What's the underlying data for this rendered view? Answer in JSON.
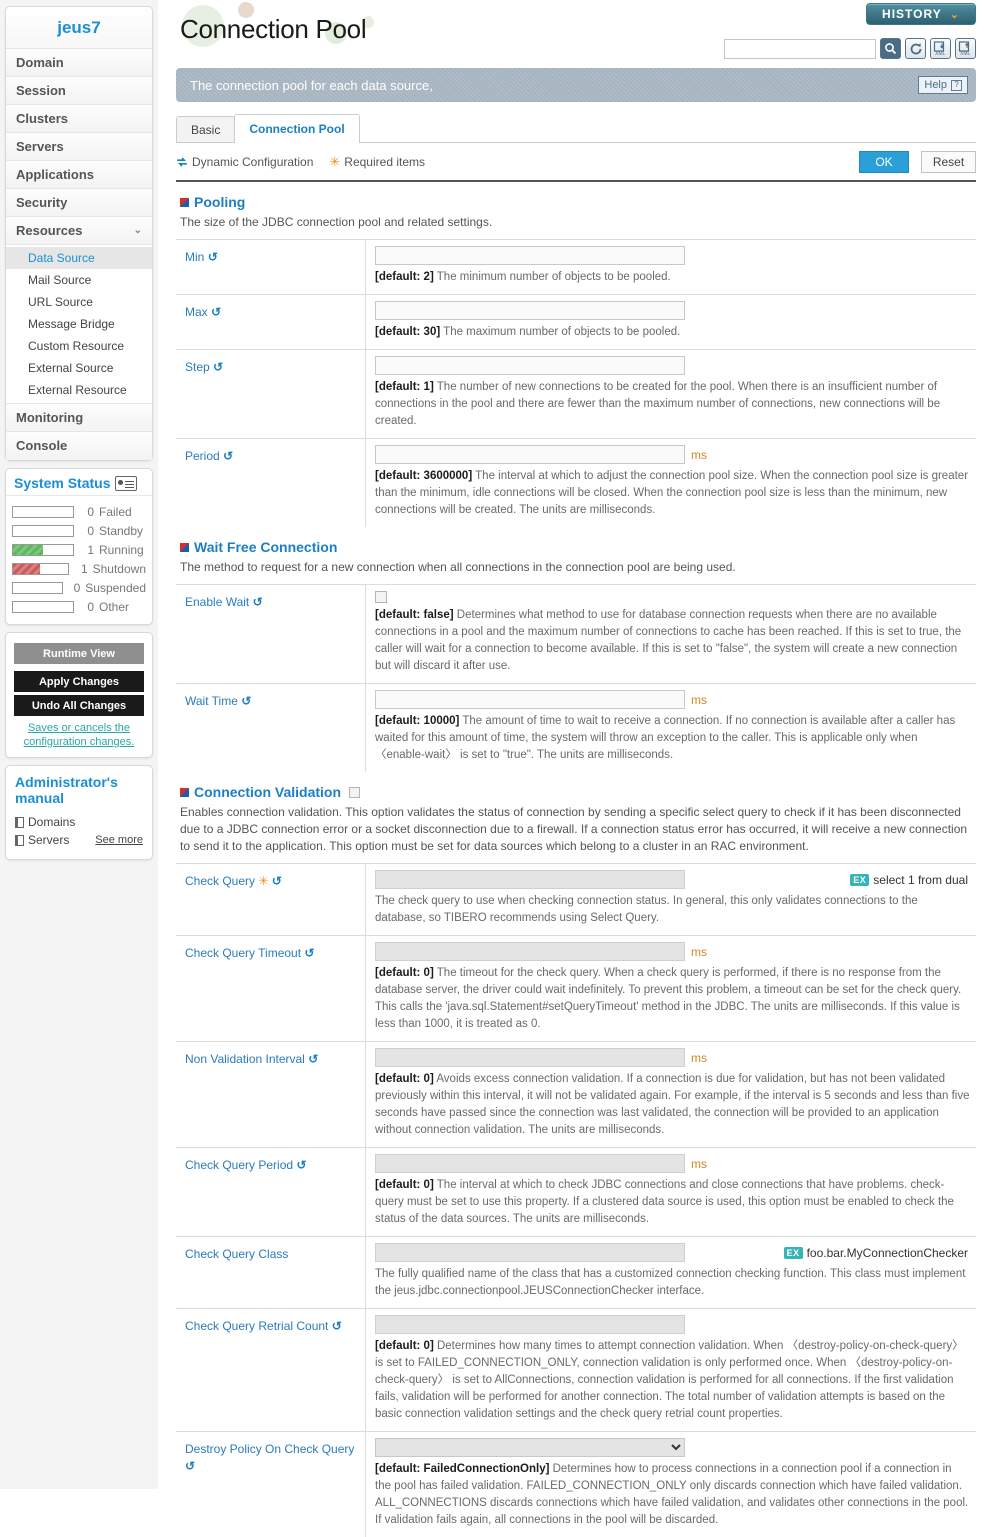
{
  "sidebar": {
    "brand": "jeus7",
    "nav": [
      {
        "label": "Domain",
        "expandable": false
      },
      {
        "label": "Session",
        "expandable": false
      },
      {
        "label": "Clusters",
        "expandable": false
      },
      {
        "label": "Servers",
        "expandable": false
      },
      {
        "label": "Applications",
        "expandable": false
      },
      {
        "label": "Security",
        "expandable": false
      },
      {
        "label": "Resources",
        "expandable": true,
        "chevron": "⌄"
      }
    ],
    "sub_items": [
      {
        "label": "Data Source",
        "active": true
      },
      {
        "label": "Mail Source",
        "active": false
      },
      {
        "label": "URL Source",
        "active": false
      },
      {
        "label": "Message Bridge",
        "active": false
      },
      {
        "label": "Custom Resource",
        "active": false
      },
      {
        "label": "External Source",
        "active": false
      },
      {
        "label": "External Resource",
        "active": false
      }
    ],
    "nav_tail": [
      {
        "label": "Monitoring"
      },
      {
        "label": "Console"
      }
    ],
    "system_status": {
      "title": "System Status",
      "rows": [
        {
          "count": "0",
          "label": "Failed",
          "pct": 0,
          "color": ""
        },
        {
          "count": "0",
          "label": "Standby",
          "pct": 0,
          "color": ""
        },
        {
          "count": "1",
          "label": "Running",
          "pct": 50,
          "color": "green"
        },
        {
          "count": "1",
          "label": "Shutdown",
          "pct": 50,
          "color": "red"
        },
        {
          "count": "0",
          "label": "Suspended",
          "pct": 0,
          "color": ""
        },
        {
          "count": "0",
          "label": "Other",
          "pct": 0,
          "color": ""
        }
      ]
    },
    "actions": {
      "runtime_view": "Runtime View",
      "apply_changes": "Apply Changes",
      "undo_all": "Undo All Changes",
      "note": "Saves or cancels the configuration changes."
    },
    "manual": {
      "title": "Administrator's manual",
      "links": [
        "Domains",
        "Servers"
      ],
      "see_more": "See more"
    }
  },
  "header": {
    "title": "Connection Pool",
    "history_label": "HISTORY",
    "history_chevron": "⌄",
    "search_value": "",
    "search_placeholder": "",
    "subtitle": "The connection pool for each data source,",
    "help_label": "Help",
    "help_mark": "?"
  },
  "tabs": [
    {
      "label": "Basic",
      "active": false
    },
    {
      "label": "Connection Pool",
      "active": true
    }
  ],
  "legend": {
    "dynamic_configuration": "Dynamic Configuration",
    "required_items": "Required items",
    "ok": "OK",
    "reset": "Reset"
  },
  "sections": [
    {
      "title": "Pooling",
      "description": "The size of the JDBC connection pool and related settings.",
      "has_checkbox": false,
      "rows": [
        {
          "label": "Min",
          "dynamic": true,
          "required": false,
          "control": "text",
          "value": "",
          "unit": "",
          "disabled": false,
          "default_label": "[default: 2]",
          "description": "The minimum number of objects to be pooled."
        },
        {
          "label": "Max",
          "dynamic": true,
          "required": false,
          "control": "text",
          "value": "",
          "unit": "",
          "disabled": false,
          "default_label": "[default: 30]",
          "description": "The maximum number of objects to be pooled."
        },
        {
          "label": "Step",
          "dynamic": true,
          "required": false,
          "control": "text",
          "value": "",
          "unit": "",
          "disabled": false,
          "default_label": "[default: 1]",
          "description": "The number of new connections to be created for the pool. When there is an insufficient number of connections in the pool and there are fewer than the maximum number of connections, new connections will be created."
        },
        {
          "label": "Period",
          "dynamic": true,
          "required": false,
          "control": "text",
          "value": "",
          "unit": "ms",
          "disabled": false,
          "default_label": "[default: 3600000]",
          "description": "The interval at which to adjust the connection pool size. When the connection pool size is greater than the minimum, idle connections will be closed. When the connection pool size is less than the minimum, new connections will be created. The units are milliseconds."
        }
      ]
    },
    {
      "title": "Wait Free Connection",
      "description": "The method to request for a new connection when all connections in the connection pool are being used.",
      "has_checkbox": false,
      "rows": [
        {
          "label": "Enable Wait",
          "dynamic": true,
          "required": false,
          "control": "checkbox",
          "value": "",
          "unit": "",
          "disabled": false,
          "default_label": "[default: false]",
          "description": "Determines what method to use for database connection requests when there are no available connections in a pool and the maximum number of connections to cache has been reached. If this is set to true, the caller will wait for a connection to become available. If this is set to \"false\", the system will create a new connection but will discard it after use."
        },
        {
          "label": "Wait Time",
          "dynamic": true,
          "required": false,
          "control": "text",
          "value": "",
          "unit": "ms",
          "disabled": false,
          "default_label": "[default: 10000]",
          "description": "The amount of time to wait to receive a connection. If no connection is available after a caller has waited for this amount of time, the system will throw an exception to the caller. This is applicable only when 〈enable-wait〉 is set to \"true\". The units are milliseconds."
        }
      ]
    },
    {
      "title": "Connection Validation",
      "description": "Enables connection validation. This option validates the status of connection by sending a specific select query to check if it has been disconnected due to a JDBC connection error or a socket disconnection due to a firewall. If a connection status error has occurred, it will receive a new connection to send it to the application. This option must be set for data sources which belong to a cluster in an RAC environment.",
      "has_checkbox": true,
      "rows": [
        {
          "label": "Check Query",
          "dynamic": true,
          "required": true,
          "control": "text",
          "value": "",
          "unit": "",
          "disabled": true,
          "example_badge": "EX",
          "example_text": "select 1 from dual",
          "default_label": "",
          "description": "The check query to use when checking connection status. In general, this only validates connections to the database, so TIBERO recommends using Select Query."
        },
        {
          "label": "Check Query Timeout",
          "dynamic": true,
          "required": false,
          "control": "text",
          "value": "",
          "unit": "ms",
          "disabled": true,
          "default_label": "[default: 0]",
          "description": "The timeout for the check query. When a check query is performed, if there is no response from the database server, the driver could wait indefinitely. To prevent this problem, a timeout can be set for the check query. This calls the 'java.sql.Statement#setQueryTimeout' method in the JDBC. The units are milliseconds. If this value is less than 1000, it is treated as 0."
        },
        {
          "label": "Non Validation Interval",
          "dynamic": true,
          "required": false,
          "control": "text",
          "value": "",
          "unit": "ms",
          "disabled": true,
          "default_label": "[default: 0]",
          "description": "Avoids excess connection validation. If a connection is due for validation, but has not been validated previously within this interval, it will not be validated again. For example, if the interval is 5 seconds and less than five seconds have passed since the connection was last validated, the connection will be provided to an application without connection validation. The units are milliseconds."
        },
        {
          "label": "Check Query Period",
          "dynamic": true,
          "required": false,
          "control": "text",
          "value": "",
          "unit": "ms",
          "disabled": true,
          "default_label": "[default: 0]",
          "description": "The interval at which to check JDBC connections and close connections that have problems. check-query must be set to use this property. If a clustered data source is used, this option must be enabled to check the status of the data sources. The units are milliseconds."
        },
        {
          "label": "Check Query Class",
          "dynamic": false,
          "required": false,
          "control": "text",
          "value": "",
          "unit": "",
          "disabled": true,
          "example_badge": "EX",
          "example_text": "foo.bar.MyConnectionChecker",
          "default_label": "",
          "description": "The fully qualified name of the class that has a customized connection checking function. This class must implement the jeus.jdbc.connectionpool.JEUSConnectionChecker interface."
        },
        {
          "label": "Check Query Retrial Count",
          "dynamic": true,
          "required": false,
          "control": "text",
          "value": "",
          "unit": "",
          "disabled": true,
          "default_label": "[default: 0]",
          "description": "Determines how many times to attempt connection validation. When 〈destroy-policy-on-check-query〉 is set to FAILED_CONNECTION_ONLY, connection validation is only performed once. When 〈destroy-policy-on-check-query〉 is set to AllConnections, connection validation is performed for all connections. If the first validation fails, validation will be performed for another connection. The total number of validation attempts is based on the basic connection validation settings and the check query retrial count properties."
        },
        {
          "label": "Destroy Policy On Check Query",
          "dynamic": true,
          "required": false,
          "control": "select",
          "value": "",
          "unit": "",
          "disabled": true,
          "options": [
            "",
            "FailedConnectionOnly",
            "AllConnections"
          ],
          "default_label": "[default: FailedConnectionOnly]",
          "description": "Determines how to process connections in a connection pool if a connection in the pool has failed validation. FAILED_CONNECTION_ONLY only discards connection which have failed validation. ALL_CONNECTIONS discards connections which have failed validation, and validates other connections in the pool. If validation fails again, all connections in the pool will be discarded."
        }
      ]
    }
  ],
  "icons": {
    "dynamic": "↻",
    "required": "✳",
    "search": "search-icon",
    "refresh": "refresh-icon",
    "xml_import": "xml-import-icon",
    "xml_export": "xml-export-icon"
  }
}
